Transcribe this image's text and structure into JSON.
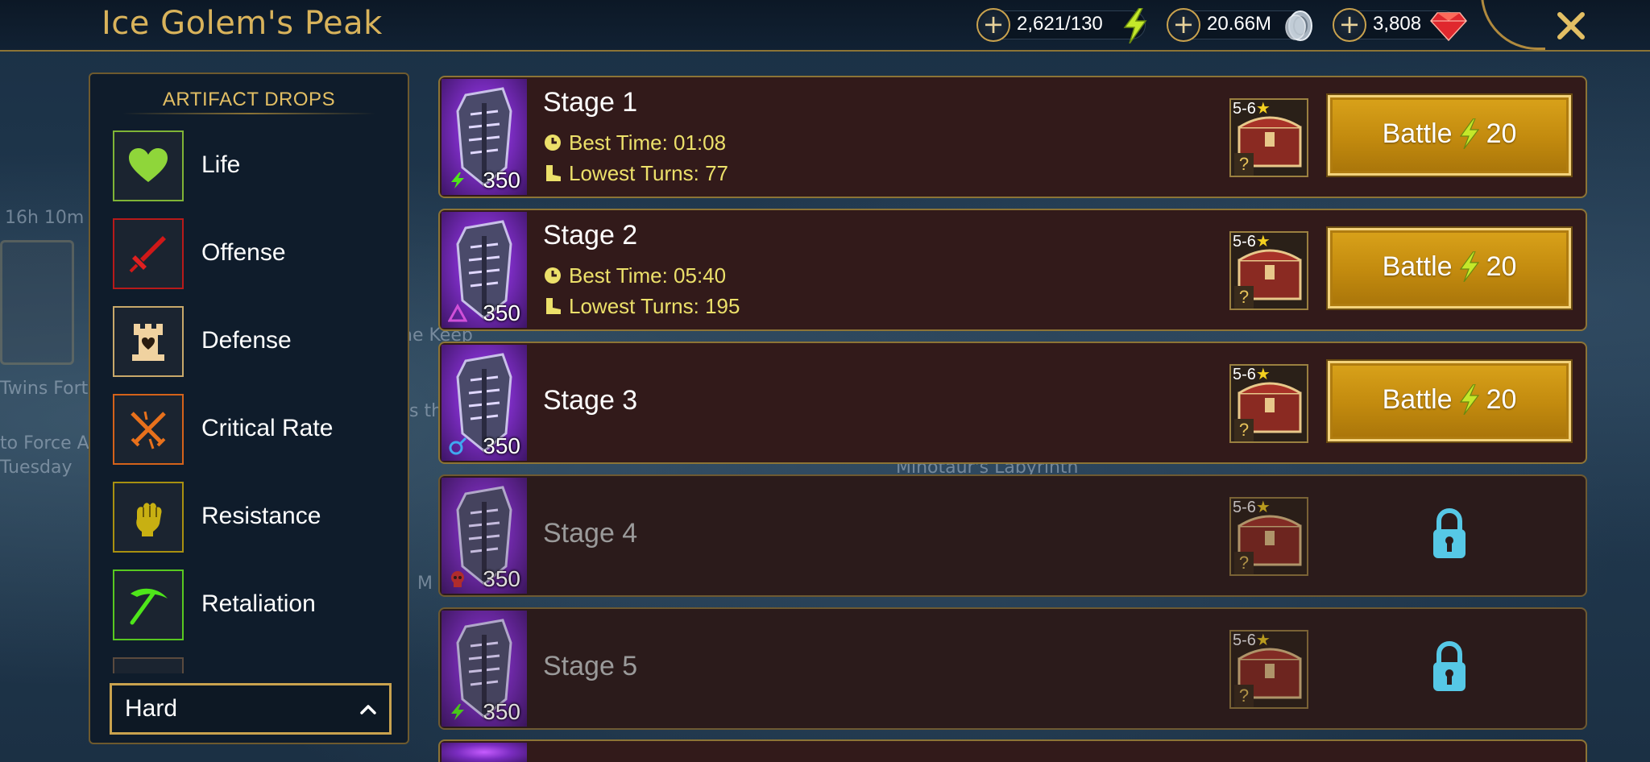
{
  "header": {
    "title": "Ice Golem's Peak",
    "resources": [
      {
        "name": "energy",
        "value": "2,621/130",
        "icon": "energy-bolt-icon"
      },
      {
        "name": "silver",
        "value": "20.66M",
        "icon": "silver-coin-icon"
      },
      {
        "name": "gems",
        "value": "3,808",
        "icon": "ruby-gem-icon"
      }
    ],
    "close_icon": "close-icon"
  },
  "background_text": [
    "16h 10m",
    "Twins Fort",
    "to Force A",
    "Tuesday",
    "he Keep",
    "s th",
    "Minotaur's Labyrinth",
    "M"
  ],
  "sidebar": {
    "title": "ARTIFACT DROPS",
    "items": [
      {
        "label": "Life",
        "icon": "heart-icon",
        "color": "#8fd63a"
      },
      {
        "label": "Offense",
        "icon": "sword-icon",
        "color": "#d01818"
      },
      {
        "label": "Defense",
        "icon": "tower-icon",
        "color": "#e8c88a"
      },
      {
        "label": "Critical Rate",
        "icon": "crossed-swords-icon",
        "color": "#e8711c"
      },
      {
        "label": "Resistance",
        "icon": "fist-icon",
        "color": "#c8b012"
      },
      {
        "label": "Retaliation",
        "icon": "pickaxe-icon",
        "color": "#4ee61a"
      }
    ],
    "difficulty": {
      "selected": "Hard"
    }
  },
  "stages": [
    {
      "name": "Stage 1",
      "power": "350",
      "affinity": "force",
      "best_time_label": "Best Time: 01:08",
      "lowest_turns_label": "Lowest Turns: 77",
      "reward_stars": "5-6",
      "reward_hint": "?",
      "battle_label": "Battle",
      "energy_cost": "20",
      "locked": false
    },
    {
      "name": "Stage 2",
      "power": "350",
      "affinity": "void",
      "best_time_label": "Best Time: 05:40",
      "lowest_turns_label": "Lowest Turns: 195",
      "reward_stars": "5-6",
      "reward_hint": "?",
      "battle_label": "Battle",
      "energy_cost": "20",
      "locked": false
    },
    {
      "name": "Stage 3",
      "power": "350",
      "affinity": "magic",
      "reward_stars": "5-6",
      "reward_hint": "?",
      "battle_label": "Battle",
      "energy_cost": "20",
      "locked": false
    },
    {
      "name": "Stage 4",
      "power": "350",
      "affinity": "spirit",
      "reward_stars": "5-6",
      "reward_hint": "?",
      "locked": true
    },
    {
      "name": "Stage 5",
      "power": "350",
      "affinity": "force",
      "reward_stars": "5-6",
      "reward_hint": "?",
      "locked": true
    }
  ],
  "colors": {
    "gold": "#d9b35b",
    "stat_text": "#ece06a",
    "battle_button": "#c28a0e",
    "lock": "#56c8e6",
    "stage_bg": "#321a1a"
  }
}
